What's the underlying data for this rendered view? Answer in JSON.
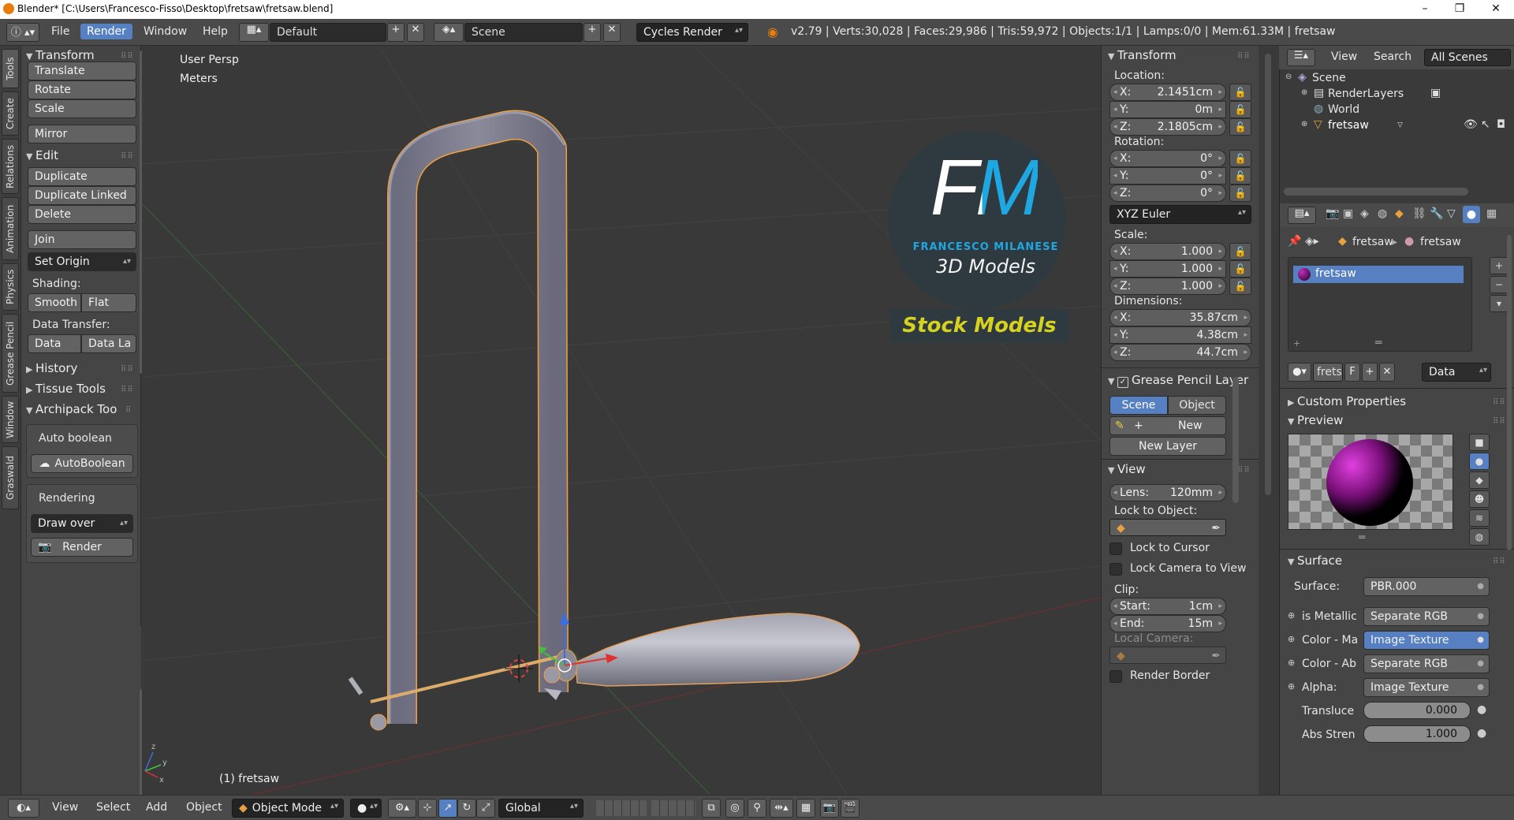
{
  "window": {
    "title": "Blender* [C:\\Users\\Francesco-Fisso\\Desktop\\fretsaw\\fretsaw.blend]",
    "minimize": "–",
    "maximize": "❐",
    "close": "✕"
  },
  "header": {
    "menus": [
      "File",
      "Render",
      "Window",
      "Help"
    ],
    "active_menu": "Render",
    "screen_layout": "Default",
    "scene": "Scene",
    "render_engine": "Cycles Render",
    "stats": "v2.79 | Verts:30,028 | Faces:29,986 | Tris:59,972 | Objects:1/1 | Lamps:0/0 | Mem:61.33M | fretsaw"
  },
  "left_tabs": [
    "Tools",
    "Create",
    "Relations",
    "Animation",
    "Physics",
    "Grease Pencil",
    "Window",
    "Graswald"
  ],
  "toolshelf": {
    "transform": {
      "title": "Transform",
      "buttons": [
        "Translate",
        "Rotate",
        "Scale",
        "Mirror"
      ]
    },
    "edit": {
      "title": "Edit",
      "buttons": [
        "Duplicate",
        "Duplicate Linked",
        "Delete",
        "Join"
      ],
      "set_origin": "Set Origin",
      "shading_label": "Shading:",
      "smooth": "Smooth",
      "flat": "Flat",
      "data_transfer_label": "Data Transfer:",
      "data": "Data",
      "data_la": "Data La"
    },
    "history": "History",
    "tissue": "Tissue Tools",
    "archipack": "Archipack Too",
    "auto_boolean_label": "Auto boolean",
    "auto_boolean_btn": "AutoBoolean",
    "rendering_label": "Rendering",
    "draw_over": "Draw over",
    "render_btn": "Render"
  },
  "viewport": {
    "view_name": "User Persp",
    "units": "Meters",
    "object_label": "(1) fretsaw",
    "logo_letters": "FM",
    "logo_name": "FRANCESCO MILANESE",
    "logo_sub": "3D Models",
    "banner": "Stock Models"
  },
  "npanel": {
    "transform_title": "Transform",
    "location_label": "Location:",
    "location": {
      "x": "2.1451cm",
      "y": "0m",
      "z": "2.1805cm"
    },
    "rotation_label": "Rotation:",
    "rotation": {
      "x": "0°",
      "y": "0°",
      "z": "0°"
    },
    "rotation_mode": "XYZ Euler",
    "scale_label": "Scale:",
    "scale": {
      "x": "1.000",
      "y": "1.000",
      "z": "1.000"
    },
    "dimensions_label": "Dimensions:",
    "dimensions": {
      "x": "35.87cm",
      "y": "4.38cm",
      "z": "44.7cm"
    },
    "axis": {
      "x": "X:",
      "y": "Y:",
      "z": "Z:"
    },
    "grease_title": "Grease Pencil Layer",
    "scene_btn": "Scene",
    "object_btn": "Object",
    "new_btn": "New",
    "new_layer_btn": "New Layer",
    "view_title": "View",
    "lens_label": "Lens:",
    "lens": "120mm",
    "lock_object_label": "Lock to Object:",
    "lock_cursor": "Lock to Cursor",
    "lock_camera": "Lock Camera to View",
    "clip_label": "Clip:",
    "start_label": "Start:",
    "start": "1cm",
    "end_label": "End:",
    "end": "15m",
    "local_camera_label": "Local Camera:",
    "render_border": "Render Border"
  },
  "outliner": {
    "view": "View",
    "search": "Search",
    "filter": "All Scenes",
    "items": [
      "Scene",
      "RenderLayers",
      "World",
      "fretsaw"
    ]
  },
  "properties": {
    "breadcrumb_object": "fretsaw",
    "breadcrumb_material": "fretsaw",
    "material_slot": "fretsaw",
    "material_name": "fretsa",
    "fake_user": "F",
    "link": "Data",
    "custom_props": "Custom Properties",
    "preview": "Preview",
    "surface_title": "Surface",
    "surface_label": "Surface:",
    "surface_value": "PBR.000",
    "inputs": [
      {
        "label": "is Metallic",
        "value": "Separate RGB"
      },
      {
        "label": "Color - Ma",
        "value": "Image Texture"
      },
      {
        "label": "Color - Ab",
        "value": "Separate RGB"
      },
      {
        "label": "Alpha:",
        "value": "Image Texture"
      }
    ],
    "translucence_label": "Transluce",
    "translucence": "0.000",
    "abs_strength_label": "Abs Stren",
    "abs_strength": "1.000"
  },
  "bottom": {
    "menus": [
      "View",
      "Select",
      "Add",
      "Object"
    ],
    "mode": "Object Mode",
    "orientation": "Global"
  },
  "colors": {
    "accent": "#5680c2",
    "panel": "#454545",
    "viewport": "#393939",
    "selection": "#f0a040"
  }
}
